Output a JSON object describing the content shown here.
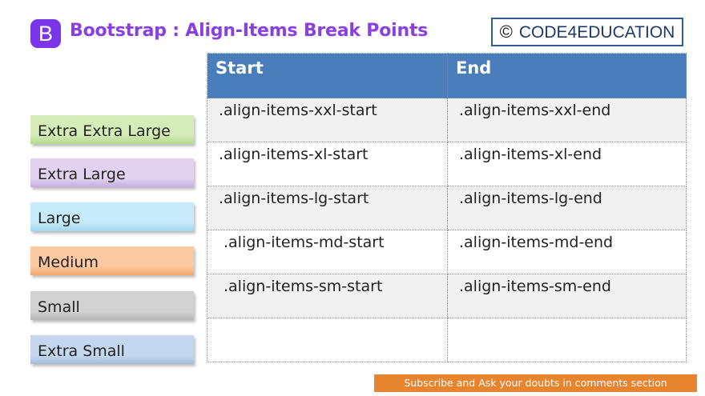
{
  "header": {
    "logo_letter": "B",
    "title": "Bootstrap :  Align-Items Break Points",
    "brand_symbol": "©",
    "brand_name": "CODE4EDUCATION"
  },
  "table": {
    "columns": [
      "Start",
      "End"
    ],
    "rows": [
      [
        ".align-items-xxl-start",
        ".align-items-xxl-end"
      ],
      [
        ".align-items-xl-start",
        ".align-items-xl-end"
      ],
      [
        ".align-items-lg-start",
        ".align-items-lg-end"
      ],
      [
        ".align-items-md-start",
        ".align-items-md-end"
      ],
      [
        ".align-items-sm-start",
        ".align-items-sm-end"
      ],
      [
        "",
        ""
      ]
    ]
  },
  "breakpoints": [
    {
      "label": "Extra Extra Large",
      "color": "#d4ecb8",
      "accent": "#b4d98a"
    },
    {
      "label": "Extra Large",
      "color": "#e1d2ef",
      "accent": "#c6acdf"
    },
    {
      "label": "Large",
      "color": "#c7eafa",
      "accent": "#9fd6ef"
    },
    {
      "label": "Medium",
      "color": "#fbc9a2",
      "accent": "#f3a56b"
    },
    {
      "label": "Small",
      "color": "#d2d2d2",
      "accent": "#b5b5b5"
    },
    {
      "label": "Extra Small",
      "color": "#c5d7ee",
      "accent": "#a2bde0"
    }
  ],
  "footer": {
    "text": "Subscribe and Ask your doubts in comments section",
    "color": "#e8832e"
  }
}
